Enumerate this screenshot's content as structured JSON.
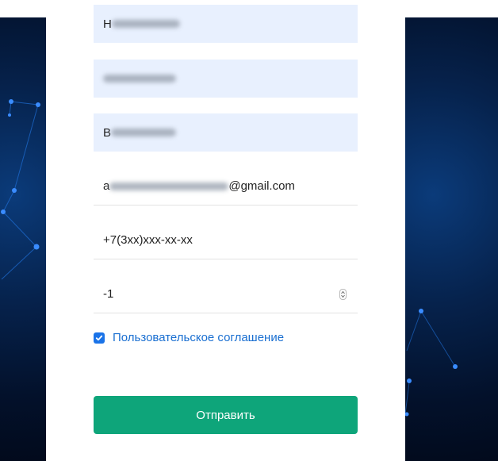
{
  "form": {
    "surname": {
      "first_char": "Н"
    },
    "name": {
      "first_char": ""
    },
    "patronymic": {
      "first_char": "В"
    },
    "email": {
      "first_char": "a",
      "domain": "@gmail.com"
    },
    "phone": {
      "value": "+7(3xx)xxx-xx-xx"
    },
    "number": {
      "value": "-1"
    },
    "agreement": {
      "checked": true,
      "label": "Пользовательское соглашение"
    },
    "submit_label": "Отправить"
  },
  "colors": {
    "accent_button": "#0ea57a",
    "link": "#1a6fd1",
    "checkbox": "#1a73e8",
    "autofill_bg": "#e8f0fe",
    "background_dark": "#03112b"
  }
}
